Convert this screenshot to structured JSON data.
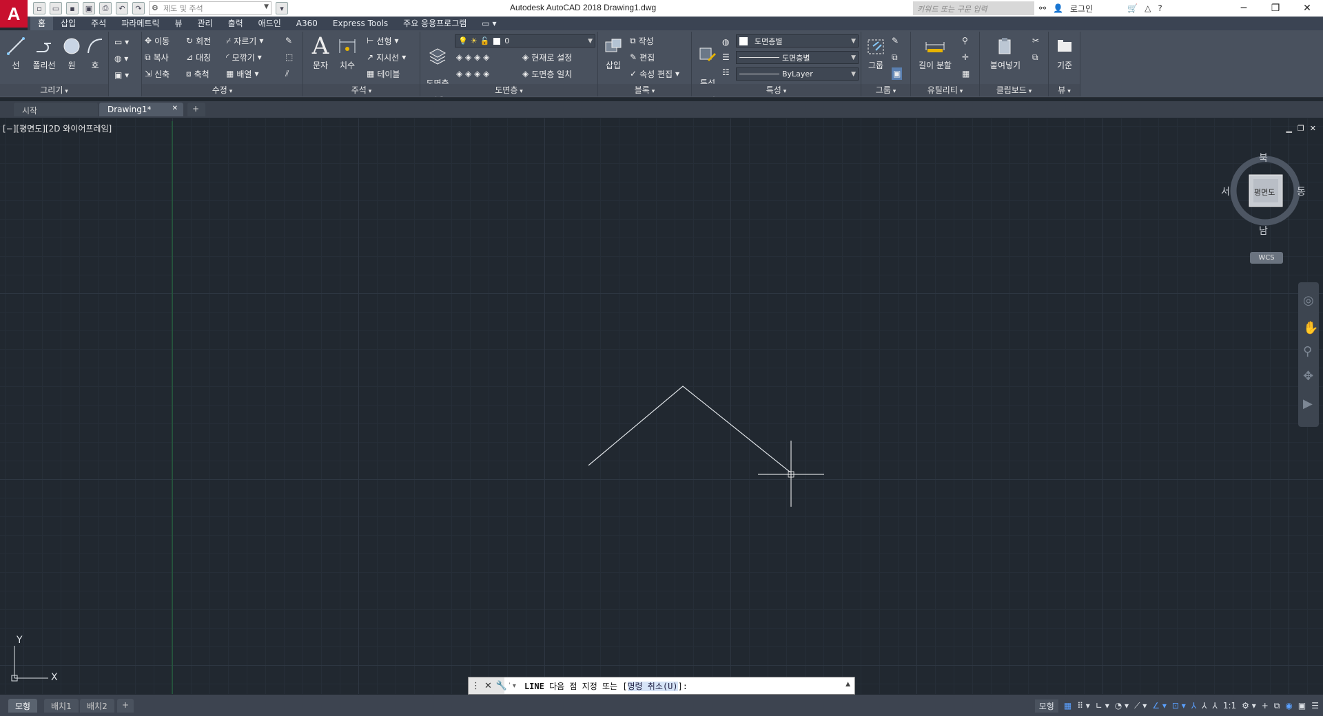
{
  "app": {
    "logo": "A",
    "window_title": "Autodesk AutoCAD 2018    Drawing1.dwg",
    "workspace_placeholder": "제도 및 주석",
    "search_placeholder": "키워드 또는 구문 입력",
    "login_label": "로그인"
  },
  "ribbon_tabs": [
    "홈",
    "삽입",
    "주석",
    "파라메트릭",
    "뷰",
    "관리",
    "출력",
    "애드인",
    "A360",
    "Express Tools",
    "주요 응용프로그램"
  ],
  "ribbon": {
    "draw": {
      "label": "그리기",
      "line": "선",
      "polyline": "폴리선",
      "circle": "원",
      "arc": "호"
    },
    "modify": {
      "label": "수정",
      "move": "이동",
      "rotate": "회전",
      "trim": "자르기",
      "copy": "복사",
      "mirror": "대칭",
      "fillet": "모깎기",
      "stretch": "신축",
      "scale": "축척",
      "array": "배열"
    },
    "annotation": {
      "label": "주석",
      "text": "문자",
      "dimension": "치수",
      "linear": "선형",
      "leader": "지시선",
      "table": "테이블"
    },
    "layers": {
      "label": "도면층",
      "properties": "도면층\n특성",
      "layer_value": "0",
      "set_current": "현재로 설정",
      "match_layer": "도면층 일치"
    },
    "block": {
      "label": "블록",
      "insert": "삽입",
      "create": "작성",
      "edit": "편집",
      "edit_attributes": "속성 편집"
    },
    "properties": {
      "label": "특성",
      "match": "특성\n일치",
      "color": "도면층별",
      "linetype": "도면층별",
      "lineweight": "ByLayer"
    },
    "groups": {
      "label": "그룹",
      "group": "그룹"
    },
    "utilities": {
      "label": "유틸리티",
      "measure": "길이 분할"
    },
    "clipboard": {
      "label": "클립보드",
      "paste": "붙여넣기"
    },
    "view": {
      "label": "뷰",
      "base": "기준"
    }
  },
  "file_tabs": [
    {
      "label": "시작"
    },
    {
      "label": "Drawing1*"
    }
  ],
  "viewport": {
    "label": "[−][평면도][2D 와이어프레임]",
    "viewcube": {
      "top": "평면도",
      "north": "북",
      "south": "남",
      "east": "동",
      "west": "서",
      "wcs": "WCS"
    },
    "ucs": {
      "x": "X",
      "y": "Y"
    }
  },
  "command_line": {
    "prefix": "ˈ ▾",
    "command": "LINE",
    "prompt": " 다음 점 지정 또는 [",
    "option": "명령 취소(U)",
    "suffix": "]:"
  },
  "layout_tabs": [
    "모형",
    "배치1",
    "배치2"
  ],
  "status": {
    "model": "모형",
    "scale": "1:1"
  },
  "colors": {
    "accent": "#c8102e",
    "ribbon_bg": "#49515e",
    "canvas_bg": "#212830"
  }
}
